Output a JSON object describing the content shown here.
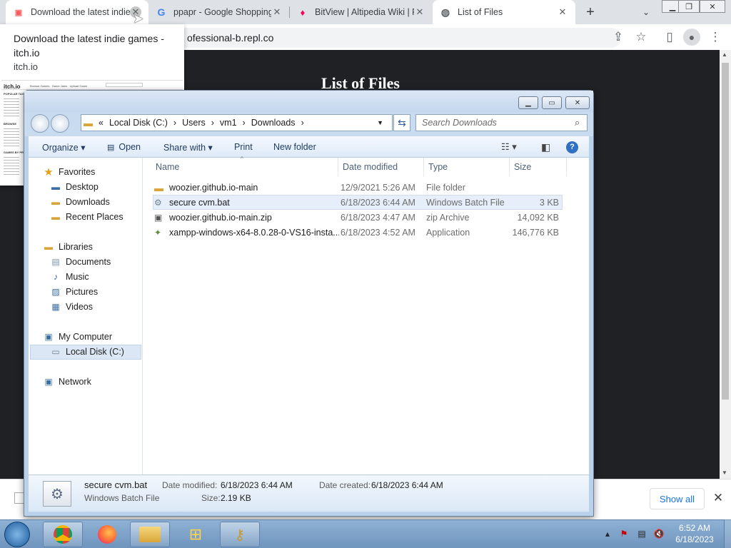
{
  "browser": {
    "tabs": [
      {
        "title": "Download the latest indie games - itch.io",
        "icon": "itchio-icon",
        "active_hover": true
      },
      {
        "title": "ppapr - Google Shopping",
        "icon": "google-icon"
      },
      {
        "title": "BitView | Altipedia Wiki | Fandom",
        "icon": "fandom-icon"
      },
      {
        "title": "List of Files",
        "icon": "globe-icon",
        "active": true
      }
    ],
    "new_tab": "+",
    "url": "ofessional-b.repl.co",
    "page_heading": "List of Files",
    "tab_hover": {
      "title": "Download the latest indie games - itch.io",
      "domain": "itch.io",
      "thumb_logo": "itch.io",
      "thumb_nav": [
        "Browse Games",
        "Game Jams",
        "Upload Game"
      ],
      "thumb_sidebar": [
        "POPULAR TAGS",
        "BROWSE",
        "GAMES BY PRICE"
      ]
    },
    "download_bar": {
      "show_all": "Show all"
    }
  },
  "explorer": {
    "breadcrumb": [
      "«",
      "Local Disk (C:)",
      "›",
      "Users",
      "›",
      "vm1",
      "›",
      "Downloads",
      "›"
    ],
    "search_placeholder": "Search Downloads",
    "commands": {
      "organize": "Organize ▾",
      "open": "Open",
      "share": "Share with ▾",
      "print": "Print",
      "new_folder": "New folder"
    },
    "nav": {
      "favorites": "Favorites",
      "desktop": "Desktop",
      "downloads": "Downloads",
      "recent": "Recent Places",
      "libraries": "Libraries",
      "documents": "Documents",
      "music": "Music",
      "pictures": "Pictures",
      "videos": "Videos",
      "computer": "My Computer",
      "local_disk": "Local Disk (C:)",
      "network": "Network"
    },
    "columns": {
      "name": "Name",
      "date": "Date modified",
      "type": "Type",
      "size": "Size"
    },
    "files": [
      {
        "name": "woozier.github.io-main",
        "date": "12/9/2021 5:26 AM",
        "type": "File folder",
        "size": "",
        "icon": "folder-icon"
      },
      {
        "name": "secure cvm.bat",
        "date": "6/18/2023 6:44 AM",
        "type": "Windows Batch File",
        "size": "3 KB",
        "icon": "batch-file-icon"
      },
      {
        "name": "woozier.github.io-main.zip",
        "date": "6/18/2023 4:47 AM",
        "type": "zip Archive",
        "size": "14,092 KB",
        "icon": "zip-file-icon"
      },
      {
        "name": "xampp-windows-x64-8.0.28-0-VS16-insta...",
        "date": "6/18/2023 4:52 AM",
        "type": "Application",
        "size": "146,776 KB",
        "icon": "installer-icon"
      }
    ],
    "details": {
      "filename": "secure cvm.bat",
      "filetype": "Windows Batch File",
      "modified_label": "Date modified:",
      "modified": "6/18/2023 6:44 AM",
      "created_label": "Date created:",
      "created": "6/18/2023 6:44 AM",
      "size_label": "Size:",
      "size": "2.19 KB"
    }
  },
  "taskbar": {
    "time": "6:52 AM",
    "date": "6/18/2023"
  }
}
